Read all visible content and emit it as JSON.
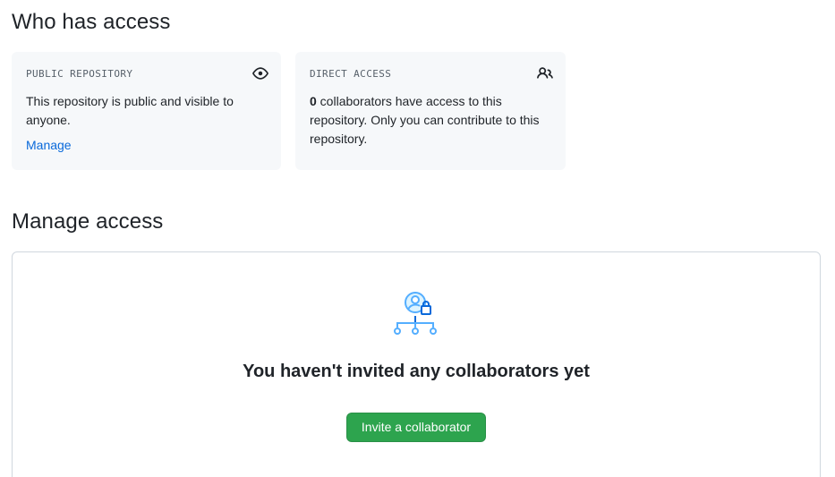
{
  "who_has_access": {
    "title": "Who has access",
    "public_card": {
      "heading": "PUBLIC REPOSITORY",
      "icon": "eye-icon",
      "description": "This repository is public and visible to anyone.",
      "link_label": "Manage"
    },
    "direct_card": {
      "heading": "DIRECT ACCESS",
      "icon": "people-icon",
      "collaborator_count": "0",
      "description_suffix": " collaborators have access to this repository. Only you can contribute to this repository."
    }
  },
  "manage_access": {
    "title": "Manage access",
    "illustration": "collaborators-lock-illustration",
    "empty_message": "You haven't invited any collaborators yet",
    "invite_button_label": "Invite a collaborator"
  },
  "colors": {
    "link": "#0969da",
    "primary_button": "#2da44e",
    "card_background": "#f6f8fa",
    "border": "#d0d7de",
    "illustration_blue": "#54aeff"
  }
}
